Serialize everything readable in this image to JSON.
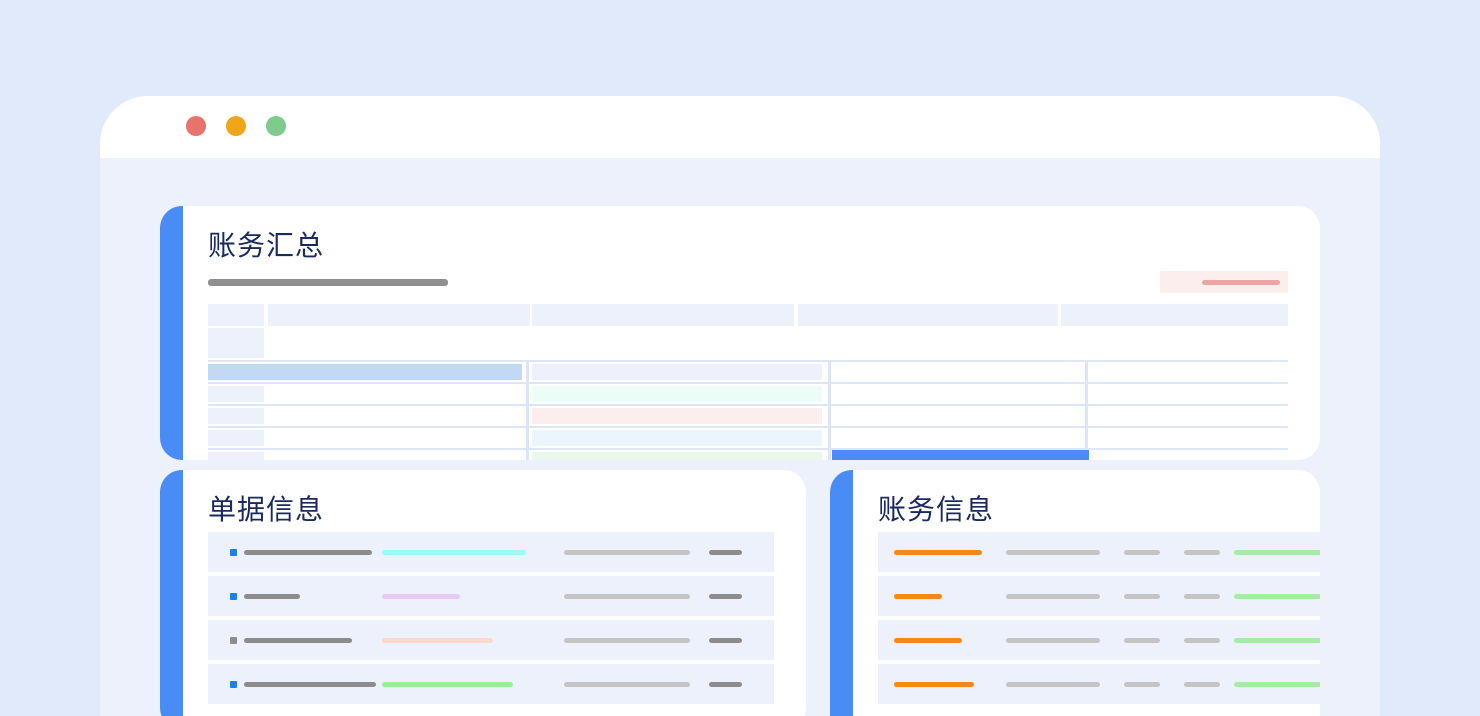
{
  "window": {
    "traffic_lights": [
      "#e8736d",
      "#eda719",
      "#7fcb8b"
    ]
  },
  "summary_card": {
    "title": "账务汇总"
  },
  "documents_card": {
    "title": "单据信息",
    "rows": [
      {
        "marker_color": "#1e7fe6",
        "accent_color": "#a2f7f7"
      },
      {
        "marker_color": "#1e7fe6",
        "accent_color": "#e7c8f7"
      },
      {
        "marker_color": "#8c8c8c",
        "accent_color": "#fbd8cc"
      },
      {
        "marker_color": "#1e7fe6",
        "accent_color": "#9fea9f"
      }
    ]
  },
  "accounts_card": {
    "title": "账务信息",
    "rows": [
      {
        "highlight_color": "#f7861b",
        "status_color": "#a5eda5"
      },
      {
        "highlight_color": "#f7861b",
        "status_color": "#a5eda5"
      },
      {
        "highlight_color": "#f7861b",
        "status_color": "#a5eda5"
      },
      {
        "highlight_color": "#f7861b",
        "status_color": "#a5eda5"
      }
    ]
  }
}
